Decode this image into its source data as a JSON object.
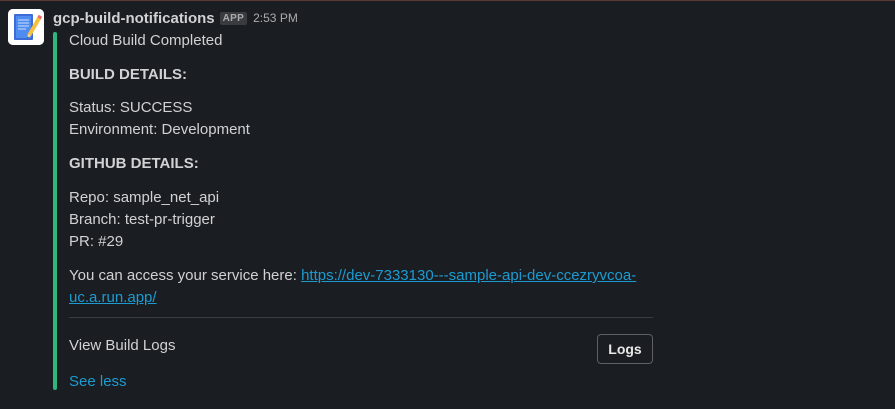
{
  "message": {
    "app_name": "gcp-build-notifications",
    "badge": "APP",
    "timestamp": "2:53 PM",
    "avatar_icon": "notepad-pencil-icon"
  },
  "attachment": {
    "accent_color": "#2eb67d",
    "title": "Cloud Build Completed",
    "build_heading": "BUILD DETAILS:",
    "status": "Status: SUCCESS",
    "environment": "Environment: Development",
    "github_heading": "GITHUB DETAILS:",
    "repo": "Repo: sample_net_api",
    "branch": "Branch: test-pr-trigger",
    "pr": "PR: #29",
    "access_prefix": "You can access your service here: ",
    "service_url_line1": "https://dev-7333130---sample-api-dev-ccezryvcoa-",
    "service_url_line2": "uc.a.run.app/",
    "view_logs_label": "View Build Logs",
    "logs_button": "Logs",
    "see_less": "See less"
  },
  "colors": {
    "background": "#1a1d21",
    "link": "#1d9bd1",
    "text": "#d1d2d3"
  }
}
